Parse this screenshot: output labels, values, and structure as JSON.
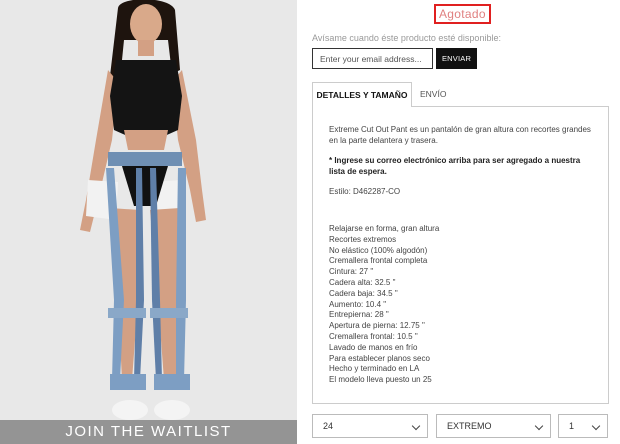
{
  "product": {
    "status": "Agotado",
    "notify_text": "Avísame cuando éste producto esté disponible:",
    "email_placeholder": "Enter your email address...",
    "send_label": "ENVIAR",
    "waitlist_label": "JOIN THE WAITLIST"
  },
  "tabs": [
    {
      "label": "DETALLES Y TAMAÑO",
      "active": true
    },
    {
      "label": "ENVÍO",
      "active": false
    }
  ],
  "details": {
    "description": "Extreme Cut Out Pant es un pantalón de gran altura con recortes grandes en la parte delantera y trasera.",
    "note": "* Ingrese su correo electrónico arriba para ser agregado a nuestra lista de espera.",
    "style": "Estilo: D462287-CO",
    "specs": [
      "Relajarse en forma, gran altura",
      "Recortes extremos",
      "No elástico (100% algodón)",
      "Cremallera frontal completa",
      "Cintura: 27 \"",
      "Cadera alta: 32.5 \"",
      "Cadera baja: 34.5 \"",
      "Aumento: 10.4 \"",
      "Entrepierna: 28 \"",
      "Apertura de pierna: 12.75 \"",
      "Cremallera frontal: 10.5 \"",
      "Lavado de manos en frío",
      "Para establecer planos seco",
      "Hecho y terminado en LA",
      "El modelo lleva puesto un 25"
    ]
  },
  "selects": {
    "size": "24",
    "cut": "EXTREMO",
    "quantity": "1"
  },
  "colors": {
    "status_border": "#e02020",
    "button_bg": "#111111"
  }
}
